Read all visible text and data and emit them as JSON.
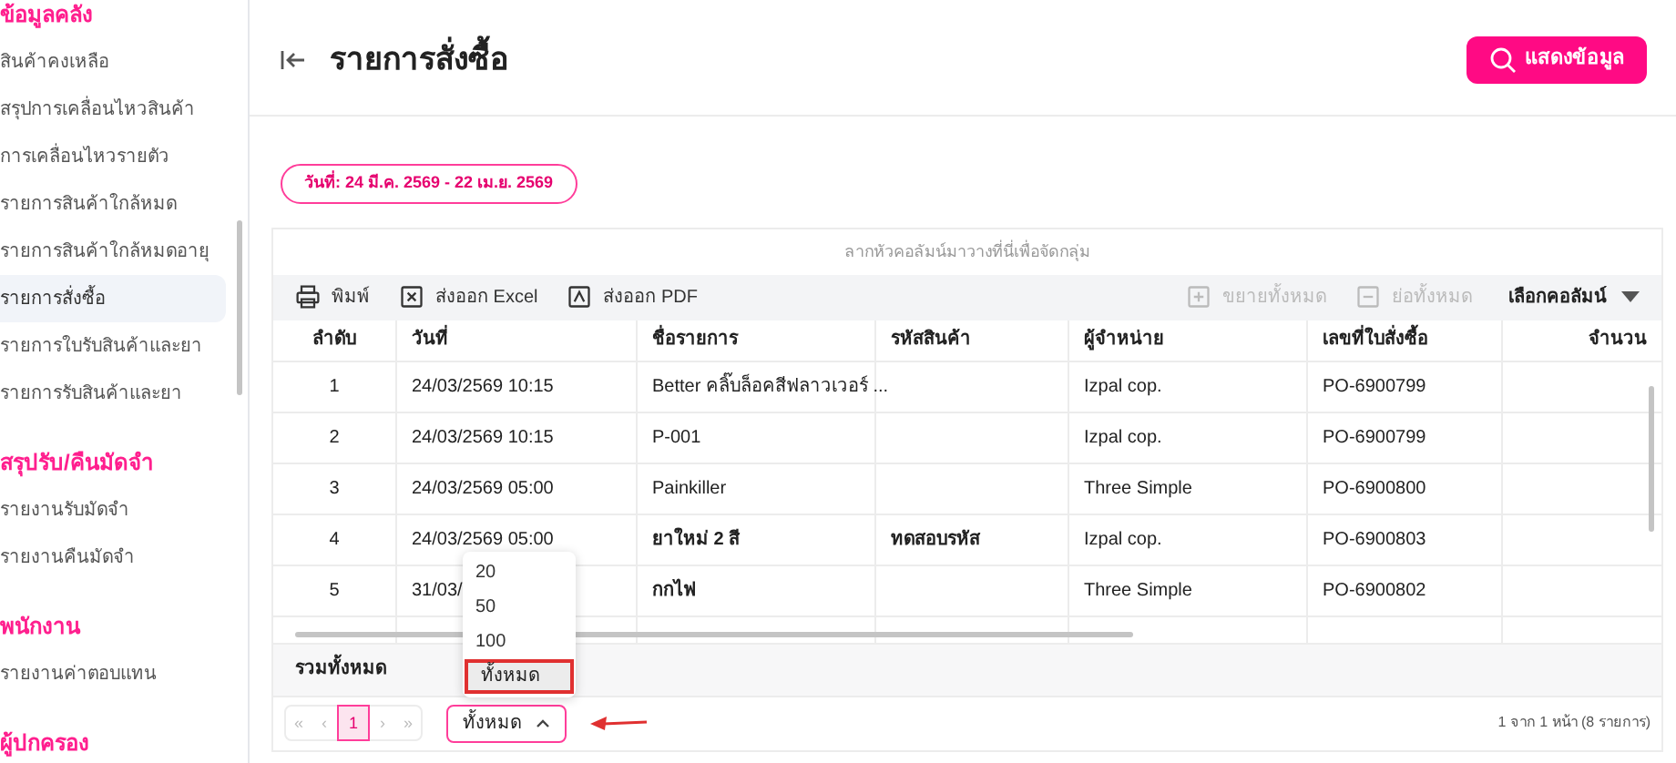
{
  "sidebar": {
    "sections": [
      {
        "heading": "ข้อมูลคลัง",
        "items": [
          {
            "label": "สินค้าคงเหลือ",
            "selected": false
          },
          {
            "label": "สรุปการเคลื่อนไหวสินค้า",
            "selected": false
          },
          {
            "label": "การเคลื่อนไหวรายตัว",
            "selected": false
          },
          {
            "label": "รายการสินค้าใกล้หมด",
            "selected": false
          },
          {
            "label": "รายการสินค้าใกล้หมดอายุ",
            "selected": false
          },
          {
            "label": "รายการสั่งซื้อ",
            "selected": true
          },
          {
            "label": "รายการใบรับสินค้าและยา",
            "selected": false
          },
          {
            "label": "รายการรับสินค้าและยา",
            "selected": false
          }
        ]
      },
      {
        "heading": "สรุปรับ/คืนมัดจำ",
        "items": [
          {
            "label": "รายงานรับมัดจำ",
            "selected": false
          },
          {
            "label": "รายงานคืนมัดจำ",
            "selected": false
          }
        ]
      },
      {
        "heading": "พนักงาน",
        "items": [
          {
            "label": "รายงานค่าตอบแทน",
            "selected": false
          }
        ]
      },
      {
        "heading": "ผู้ปกครอง"
      }
    ]
  },
  "header": {
    "title": "รายการสั่งซื้อ",
    "action": "แสดงข้อมูล"
  },
  "date_filter": "วันที่: 24 มี.ค. 2569 - 22 เม.ย. 2569",
  "table": {
    "group_hint": "ลากหัวคอลัมน์มาวางที่นี่เพื่อจัดกลุ่ม",
    "toolbar": [
      {
        "kind": "print",
        "label": "พิมพ์",
        "disabled": false
      },
      {
        "kind": "excel",
        "label": "ส่งออก Excel",
        "disabled": false
      },
      {
        "kind": "pdf",
        "label": "ส่งออก PDF",
        "disabled": false
      },
      {
        "kind": "expand",
        "label": "ขยายทั้งหมด",
        "disabled": true
      },
      {
        "kind": "collapse",
        "label": "ย่อทั้งหมด",
        "disabled": true
      }
    ],
    "column_chooser": "เลือกคอลัมน์",
    "columns": [
      "ลำดับ",
      "วันที่",
      "ชื่อรายการ",
      "รหัสสินค้า",
      "ผู้จำหน่าย",
      "เลขที่ใบสั่งซื้อ",
      "จำนวน"
    ],
    "rows": [
      {
        "cells": [
          "1",
          "24/03/2569 10:15",
          "Better คลิ๊บล็อคสีฟลาวเวอร์ ...",
          "",
          "Izpal cop.",
          "PO-6900799"
        ],
        "bold": false
      },
      {
        "cells": [
          "2",
          "24/03/2569 10:15",
          "P-001",
          "",
          "Izpal cop.",
          "PO-6900799"
        ],
        "bold": false
      },
      {
        "cells": [
          "3",
          "24/03/2569 05:00",
          "Painkiller",
          "",
          "Three Simple",
          "PO-6900800"
        ],
        "bold": false
      },
      {
        "cells": [
          "4",
          "24/03/2569 05:00",
          "ยาใหม่ 2 สี",
          "ทดสอบรหัส",
          "Izpal cop.",
          "PO-6900803"
        ],
        "bold": true
      },
      {
        "cells": [
          "5",
          "31/03/",
          "กกไฟ",
          "",
          "Three Simple",
          "PO-6900802"
        ],
        "bold": true
      }
    ],
    "total_label": "รวมทั้งหมด",
    "pager": {
      "first": "«",
      "prev": "‹",
      "pages": [
        {
          "label": "1",
          "selected": true
        }
      ],
      "next": "›",
      "last": "»",
      "page_size": "ทั้งหมด",
      "page_size_options": [
        {
          "label": "20",
          "selected": false
        },
        {
          "label": "50",
          "selected": false
        },
        {
          "label": "100",
          "selected": false
        },
        {
          "label": "ทั้งหมด",
          "selected": true
        }
      ],
      "info": "1 จาก 1 หน้า (8 รายการ)"
    }
  }
}
